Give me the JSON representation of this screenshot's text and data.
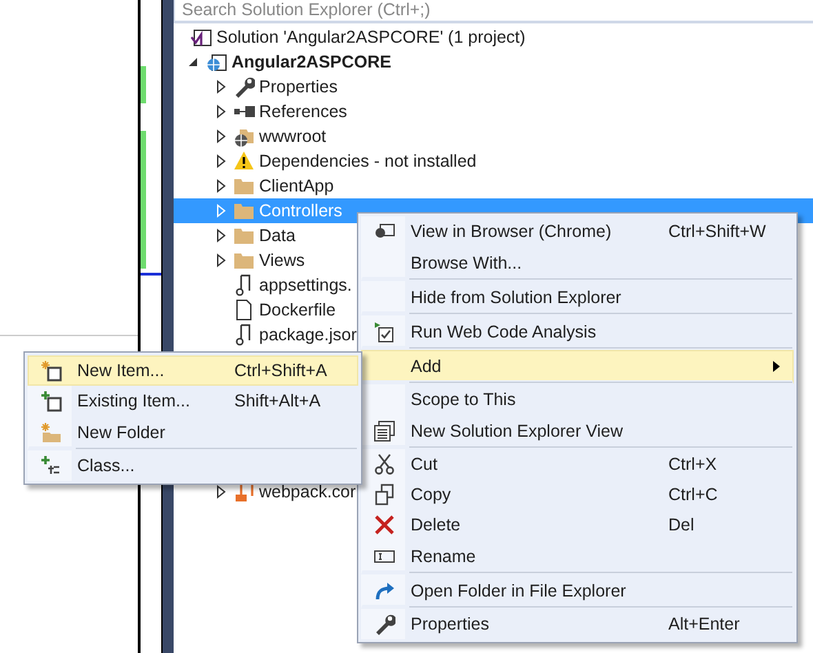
{
  "search": {
    "placeholder": "Search Solution Explorer (Ctrl+;)"
  },
  "tree": [
    {
      "label": "Solution 'Angular2ASPCORE' (1 project)",
      "bold": false,
      "selected": false,
      "children": [
        {
          "label": "Angular2ASPCORE",
          "bold": true,
          "expanded": true,
          "selected": false,
          "children": [
            {
              "label": "Properties",
              "expanded": false,
              "selected": false
            },
            {
              "label": "References",
              "expanded": false,
              "selected": false
            },
            {
              "label": "wwwroot",
              "expanded": false,
              "selected": false
            },
            {
              "label": "Dependencies - not installed",
              "expanded": false,
              "selected": false
            },
            {
              "label": "ClientApp",
              "expanded": false,
              "selected": false
            },
            {
              "label": "Controllers",
              "expanded": false,
              "selected": true
            },
            {
              "label": "Data",
              "expanded": false,
              "selected": false
            },
            {
              "label": "Views",
              "expanded": false,
              "selected": false
            },
            {
              "label": "appsettings.",
              "selected": false
            },
            {
              "label": "Dockerfile",
              "selected": false
            },
            {
              "label": "package.jsor",
              "selected": false
            },
            {
              "label": "webpack.cor",
              "expanded": false,
              "selected": false
            }
          ]
        }
      ]
    }
  ],
  "context_menu": [
    {
      "label": "View in Browser (Chrome)",
      "shortcut": "Ctrl+Shift+W",
      "highlighted": false
    },
    {
      "label": "Browse With...",
      "highlighted": false,
      "separator_after": true
    },
    {
      "label": "Hide from Solution Explorer",
      "highlighted": false,
      "separator_after": true
    },
    {
      "label": "Run Web Code Analysis",
      "highlighted": false,
      "separator_after": true
    },
    {
      "label": "Add",
      "highlighted": true,
      "has_submenu": true,
      "separator_after": true
    },
    {
      "label": "Scope to This",
      "highlighted": false
    },
    {
      "label": "New Solution Explorer View",
      "highlighted": false,
      "separator_after": true
    },
    {
      "label": "Cut",
      "shortcut": "Ctrl+X",
      "highlighted": false
    },
    {
      "label": "Copy",
      "shortcut": "Ctrl+C",
      "highlighted": false
    },
    {
      "label": "Delete",
      "shortcut": "Del",
      "highlighted": false
    },
    {
      "label": "Rename",
      "highlighted": false,
      "separator_after": true
    },
    {
      "label": "Open Folder in File Explorer",
      "highlighted": false,
      "separator_after": true
    },
    {
      "label": "Properties",
      "shortcut": "Alt+Enter",
      "highlighted": false
    }
  ],
  "submenu": [
    {
      "label": "New Item...",
      "shortcut": "Ctrl+Shift+A",
      "highlighted": true
    },
    {
      "label": "Existing Item...",
      "shortcut": "Shift+Alt+A",
      "highlighted": false
    },
    {
      "label": "New Folder",
      "highlighted": false,
      "separator_after": true
    },
    {
      "label": "Class...",
      "highlighted": false
    }
  ]
}
